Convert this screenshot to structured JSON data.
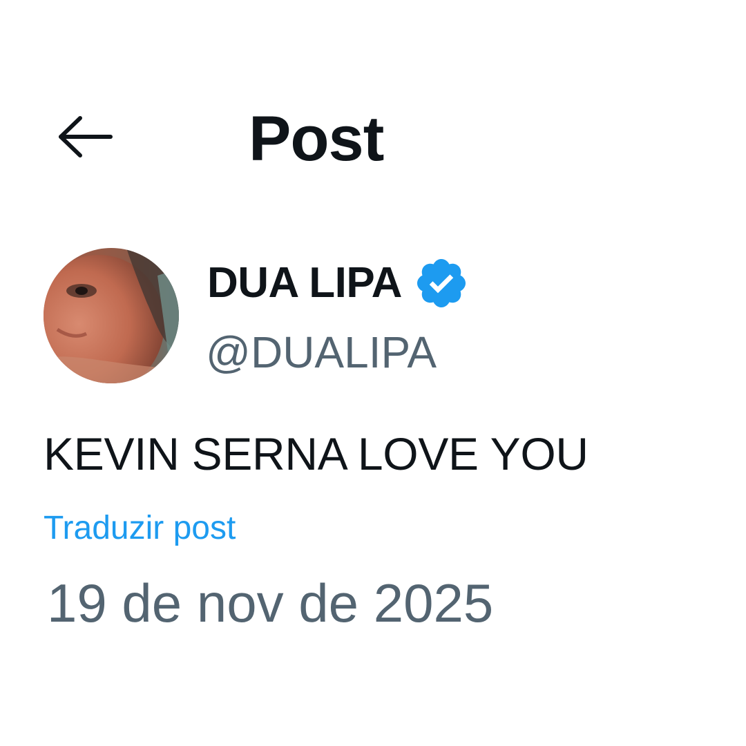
{
  "header": {
    "back_icon": "arrow-left-icon",
    "title": "Post"
  },
  "post": {
    "author": {
      "display_name": "DUA LIPA",
      "handle": "@DUALIPA",
      "verified": true,
      "verified_icon": "verified-badge-icon",
      "avatar": "profile-photo"
    },
    "text": "KEVIN SERNA LOVE YOU",
    "translate_label": "Traduzir post",
    "date": "19 de nov de 2025"
  },
  "colors": {
    "text_primary": "#0f1419",
    "text_secondary": "#536471",
    "accent": "#1d9bf0",
    "background": "#ffffff"
  }
}
